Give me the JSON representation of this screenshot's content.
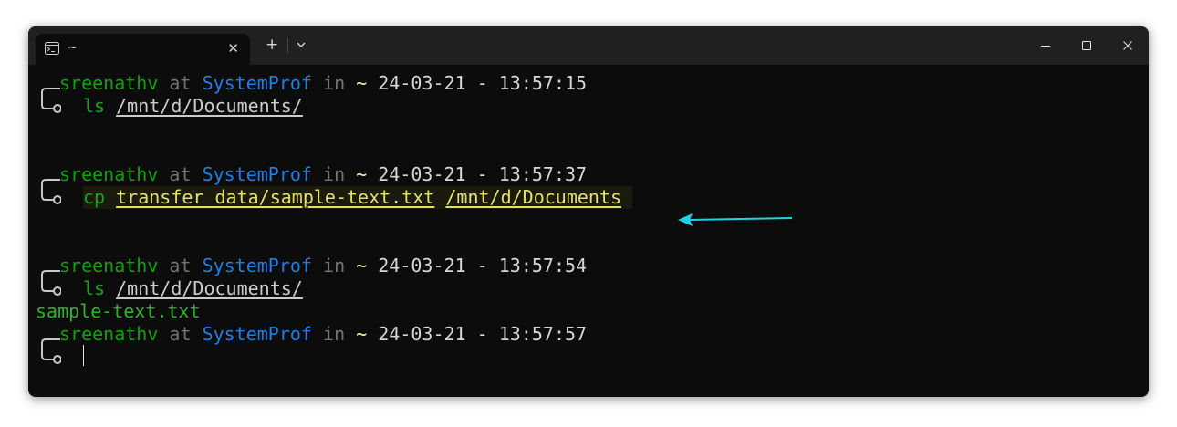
{
  "window": {
    "tab_title": "~",
    "tab_close": "✕",
    "new_tab": "+",
    "icons": {
      "tab": "terminal-icon",
      "dropdown": "chevron-down-icon",
      "minimize": "minimize-icon",
      "maximize": "maximize-icon",
      "close": "close-icon"
    }
  },
  "colors": {
    "background": "#0c0c0c",
    "titlebar": "#202020",
    "user": "#13a10e",
    "host": "#1f7fe8",
    "dim": "#737373",
    "tilde": "#f9f1a5",
    "arrow": "#1fd3e6"
  },
  "prompts": [
    {
      "user": "sreenathv",
      "at": "at",
      "host": "SystemProf",
      "in": "in",
      "dir": "~",
      "date": "24-03-21",
      "dash": "-",
      "time": "13:57:15",
      "command": "ls",
      "args": [
        "/mnt/d/Documents/"
      ]
    },
    {
      "user": "sreenathv",
      "at": "at",
      "host": "SystemProf",
      "in": "in",
      "dir": "~",
      "date": "24-03-21",
      "dash": "-",
      "time": "13:57:37",
      "command": "cp",
      "args": [
        "transfer_data/sample-text.txt",
        "/mnt/d/Documents"
      ]
    },
    {
      "user": "sreenathv",
      "at": "at",
      "host": "SystemProf",
      "in": "in",
      "dir": "~",
      "date": "24-03-21",
      "dash": "-",
      "time": "13:57:54",
      "command": "ls",
      "args": [
        "/mnt/d/Documents/"
      ],
      "output": "sample-text.txt"
    },
    {
      "user": "sreenathv",
      "at": "at",
      "host": "SystemProf",
      "in": "in",
      "dir": "~",
      "date": "24-03-21",
      "dash": "-",
      "time": "13:57:57",
      "command": ""
    }
  ]
}
